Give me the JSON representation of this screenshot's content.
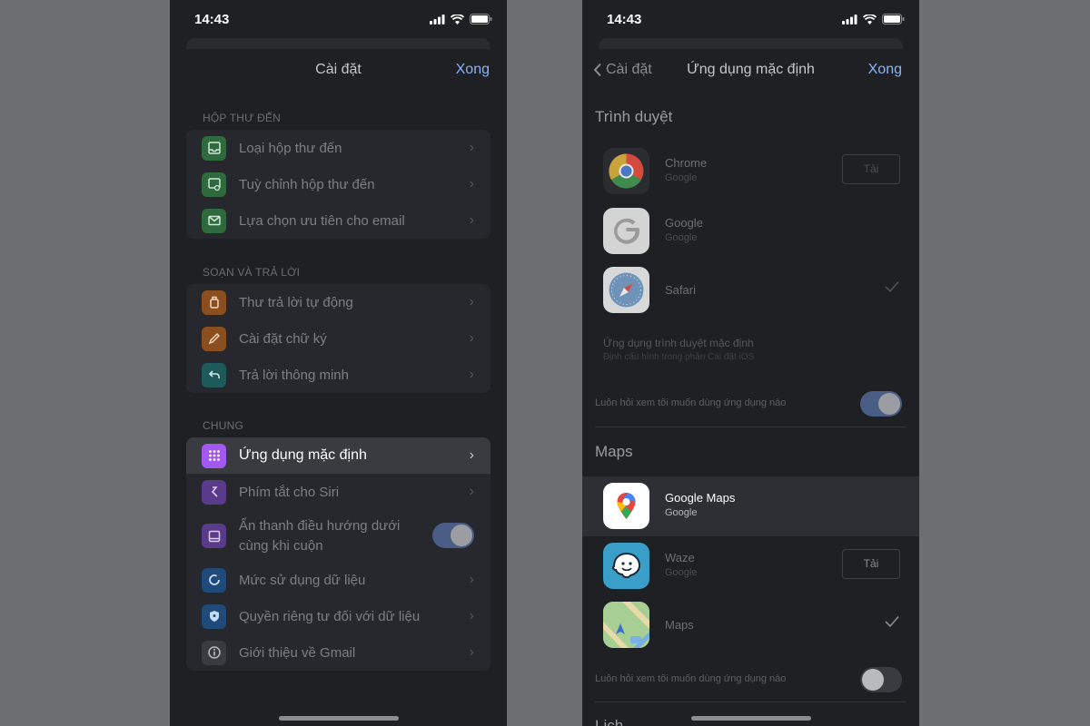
{
  "status": {
    "time": "14:43"
  },
  "left": {
    "nav_title": "Cài đặt",
    "nav_done": "Xong",
    "sections": [
      {
        "header": "HỘP THƯ ĐẾN",
        "items": [
          {
            "label": "Loại hộp thư đến"
          },
          {
            "label": "Tuỳ chỉnh hộp thư đến"
          },
          {
            "label": "Lựa chọn ưu tiên cho email"
          }
        ]
      },
      {
        "header": "SOẠN VÀ TRẢ LỜI",
        "items": [
          {
            "label": "Thư trả lời tự động"
          },
          {
            "label": "Cài đặt chữ ký"
          },
          {
            "label": "Trả lời thông minh"
          }
        ]
      },
      {
        "header": "CHUNG",
        "items": [
          {
            "label": "Ứng dụng mặc định"
          },
          {
            "label": "Phím tắt cho Siri"
          },
          {
            "label_line1": "Ẩn thanh điều hướng dưới",
            "label_line2": "cùng khi cuộn"
          },
          {
            "label": "Mức sử dụng dữ liệu"
          },
          {
            "label": "Quyền riêng tư đối với dữ liệu"
          },
          {
            "label": "Giới thiệu về Gmail"
          }
        ]
      }
    ]
  },
  "right": {
    "nav_back": "Cài đặt",
    "nav_title": "Ứng dụng mặc định",
    "nav_done": "Xong",
    "browser": {
      "title": "Trình duyệt",
      "apps": [
        {
          "name": "Chrome",
          "publisher": "Google",
          "action": "Tải"
        },
        {
          "name": "Google",
          "publisher": "Google"
        },
        {
          "name": "Safari"
        }
      ],
      "default_title": "Ứng dụng trình duyệt mặc định",
      "default_sub": "Định cấu hình trong phần Cài đặt iOS",
      "ask_label": "Luôn hỏi xem tôi muốn dùng ứng dụng nào"
    },
    "maps": {
      "title": "Maps",
      "apps": [
        {
          "name": "Google Maps",
          "publisher": "Google"
        },
        {
          "name": "Waze",
          "publisher": "Google",
          "action": "Tải"
        },
        {
          "name": "Maps"
        }
      ],
      "ask_label": "Luôn hỏi xem tôi muốn dùng ứng dụng nào"
    },
    "next_title": "Lịch"
  },
  "colors": {
    "accent": "#8ab4f8",
    "background": "#1f2024",
    "page_bg": "#6d6e72"
  },
  "toggles": {
    "hide_nav_bar": true,
    "browser_always_ask": true,
    "maps_always_ask": false
  }
}
